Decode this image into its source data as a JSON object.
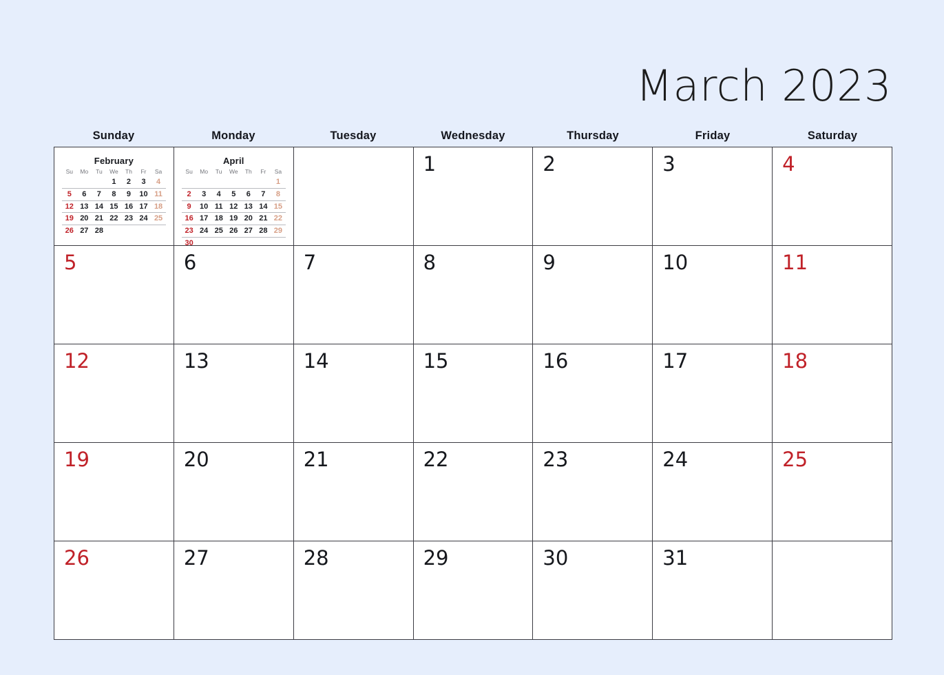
{
  "title": "March 2023",
  "weekday_headers": [
    "Sunday",
    "Monday",
    "Tuesday",
    "Wednesday",
    "Thursday",
    "Friday",
    "Saturday"
  ],
  "colors": {
    "page_background": "#e6eefc",
    "cell_background": "#ffffff",
    "grid_line": "#3b3b42",
    "weekend_red": "#c02128",
    "mini_saturday": "#d79f86",
    "mini_weekday_label": "#74767c",
    "text": "#16181d"
  },
  "mini_calendars": [
    {
      "name": "february",
      "title": "February",
      "weekday_labels": [
        "Su",
        "Mo",
        "Tu",
        "We",
        "Th",
        "Fr",
        "Sa"
      ],
      "weeks": [
        [
          "",
          "",
          "",
          "1",
          "2",
          "3",
          "4"
        ],
        [
          "5",
          "6",
          "7",
          "8",
          "9",
          "10",
          "11"
        ],
        [
          "12",
          "13",
          "14",
          "15",
          "16",
          "17",
          "18"
        ],
        [
          "19",
          "20",
          "21",
          "22",
          "23",
          "24",
          "25"
        ],
        [
          "26",
          "27",
          "28",
          "",
          "",
          "",
          ""
        ]
      ]
    },
    {
      "name": "april",
      "title": "April",
      "weekday_labels": [
        "Su",
        "Mo",
        "Tu",
        "We",
        "Th",
        "Fr",
        "Sa"
      ],
      "weeks": [
        [
          "",
          "",
          "",
          "",
          "",
          "",
          "1"
        ],
        [
          "2",
          "3",
          "4",
          "5",
          "6",
          "7",
          "8"
        ],
        [
          "9",
          "10",
          "11",
          "12",
          "13",
          "14",
          "15"
        ],
        [
          "16",
          "17",
          "18",
          "19",
          "20",
          "21",
          "22"
        ],
        [
          "23",
          "24",
          "25",
          "26",
          "27",
          "28",
          "29"
        ],
        [
          "30",
          "",
          "",
          "",
          "",
          "",
          ""
        ]
      ]
    }
  ],
  "grid": {
    "rows": [
      [
        {
          "day": "",
          "kind": "mini",
          "mini": "february"
        },
        {
          "day": "",
          "kind": "mini",
          "mini": "april"
        },
        {
          "day": "",
          "kind": "empty"
        },
        {
          "day": "1",
          "kind": "day",
          "weekend": false
        },
        {
          "day": "2",
          "kind": "day",
          "weekend": false
        },
        {
          "day": "3",
          "kind": "day",
          "weekend": false
        },
        {
          "day": "4",
          "kind": "day",
          "weekend": true
        }
      ],
      [
        {
          "day": "5",
          "kind": "day",
          "weekend": true
        },
        {
          "day": "6",
          "kind": "day",
          "weekend": false
        },
        {
          "day": "7",
          "kind": "day",
          "weekend": false
        },
        {
          "day": "8",
          "kind": "day",
          "weekend": false
        },
        {
          "day": "9",
          "kind": "day",
          "weekend": false
        },
        {
          "day": "10",
          "kind": "day",
          "weekend": false
        },
        {
          "day": "11",
          "kind": "day",
          "weekend": true
        }
      ],
      [
        {
          "day": "12",
          "kind": "day",
          "weekend": true
        },
        {
          "day": "13",
          "kind": "day",
          "weekend": false
        },
        {
          "day": "14",
          "kind": "day",
          "weekend": false
        },
        {
          "day": "15",
          "kind": "day",
          "weekend": false
        },
        {
          "day": "16",
          "kind": "day",
          "weekend": false
        },
        {
          "day": "17",
          "kind": "day",
          "weekend": false
        },
        {
          "day": "18",
          "kind": "day",
          "weekend": true
        }
      ],
      [
        {
          "day": "19",
          "kind": "day",
          "weekend": true
        },
        {
          "day": "20",
          "kind": "day",
          "weekend": false
        },
        {
          "day": "21",
          "kind": "day",
          "weekend": false
        },
        {
          "day": "22",
          "kind": "day",
          "weekend": false
        },
        {
          "day": "23",
          "kind": "day",
          "weekend": false
        },
        {
          "day": "24",
          "kind": "day",
          "weekend": false
        },
        {
          "day": "25",
          "kind": "day",
          "weekend": true
        }
      ],
      [
        {
          "day": "26",
          "kind": "day",
          "weekend": true
        },
        {
          "day": "27",
          "kind": "day",
          "weekend": false
        },
        {
          "day": "28",
          "kind": "day",
          "weekend": false
        },
        {
          "day": "29",
          "kind": "day",
          "weekend": false
        },
        {
          "day": "30",
          "kind": "day",
          "weekend": false
        },
        {
          "day": "31",
          "kind": "day",
          "weekend": false
        },
        {
          "day": "",
          "kind": "empty"
        }
      ]
    ]
  }
}
